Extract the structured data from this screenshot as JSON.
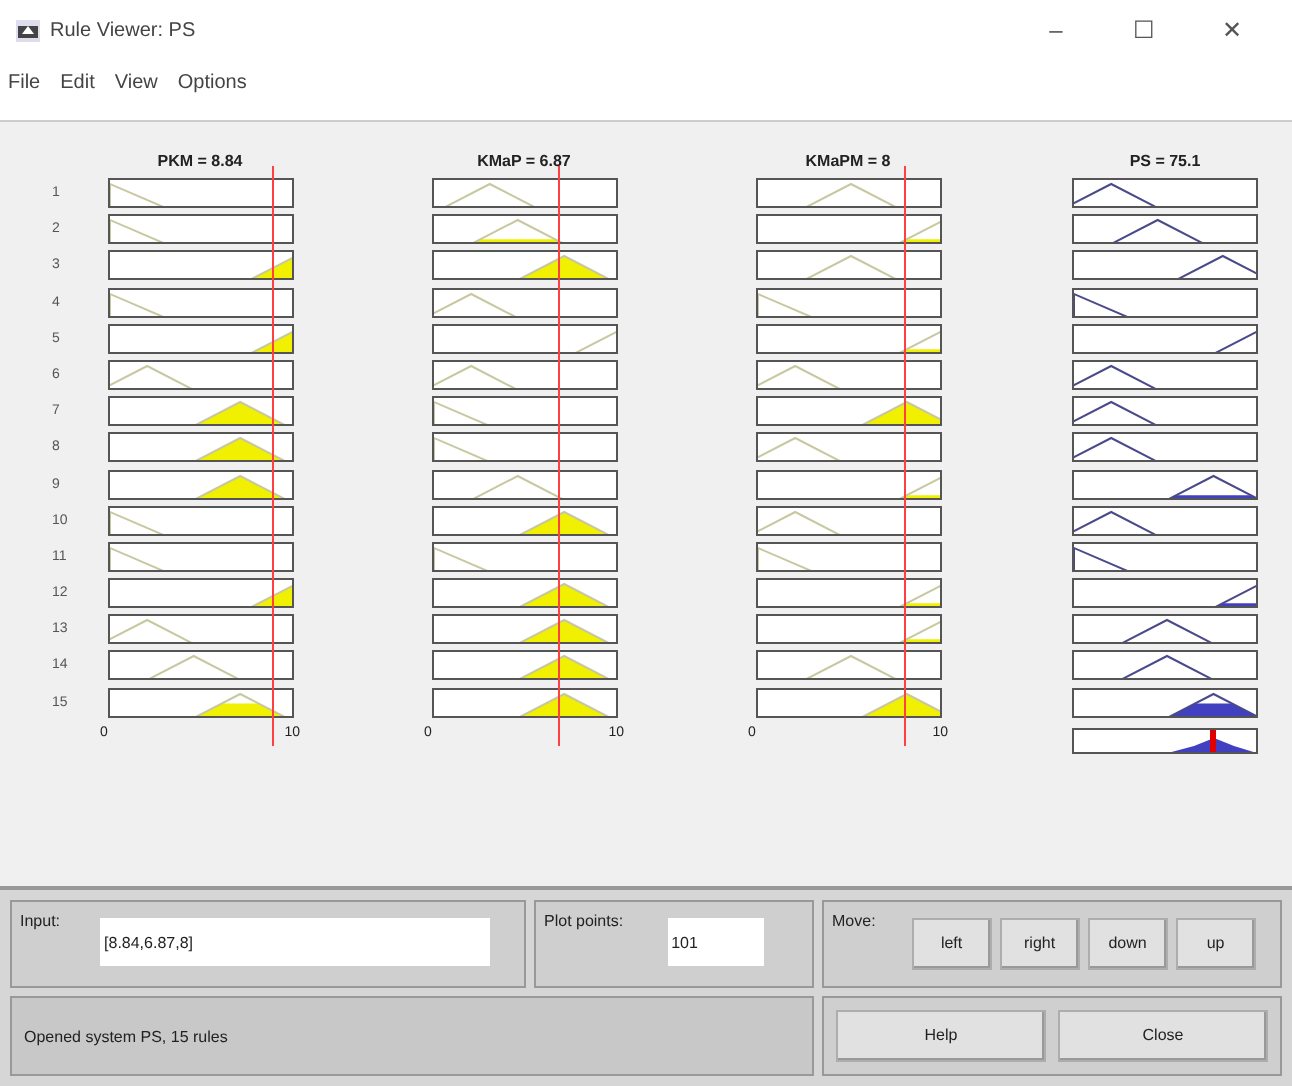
{
  "window": {
    "title": "Rule Viewer: PS",
    "controls": [
      "–",
      "☐",
      "✕"
    ]
  },
  "menu": [
    "File",
    "Edit",
    "View",
    "Options"
  ],
  "rule_numbers": [
    "1",
    "2",
    "3",
    "4",
    "5",
    "6",
    "7",
    "8",
    "9",
    "10",
    "11",
    "12",
    "13",
    "14",
    "15"
  ],
  "inputs": [
    {
      "label": "PKM = 8.84",
      "axis_min": "0",
      "axis_max": "10"
    },
    {
      "label": "KMaP = 6.87",
      "axis_min": "0",
      "axis_max": "10"
    },
    {
      "label": "KMaPM = 8",
      "axis_min": "0",
      "axis_max": "10"
    }
  ],
  "output": {
    "label": "PS = 75.1"
  },
  "input_field": {
    "label": "Input:",
    "value": "[8.84,6.87,8]"
  },
  "plot_points": {
    "label": "Plot points:",
    "value": "101"
  },
  "move": {
    "label": "Move:",
    "buttons": [
      "left",
      "right",
      "down",
      "up"
    ]
  },
  "status": "Opened system PS, 15 rules",
  "buttons": [
    "Help",
    "Close"
  ]
}
